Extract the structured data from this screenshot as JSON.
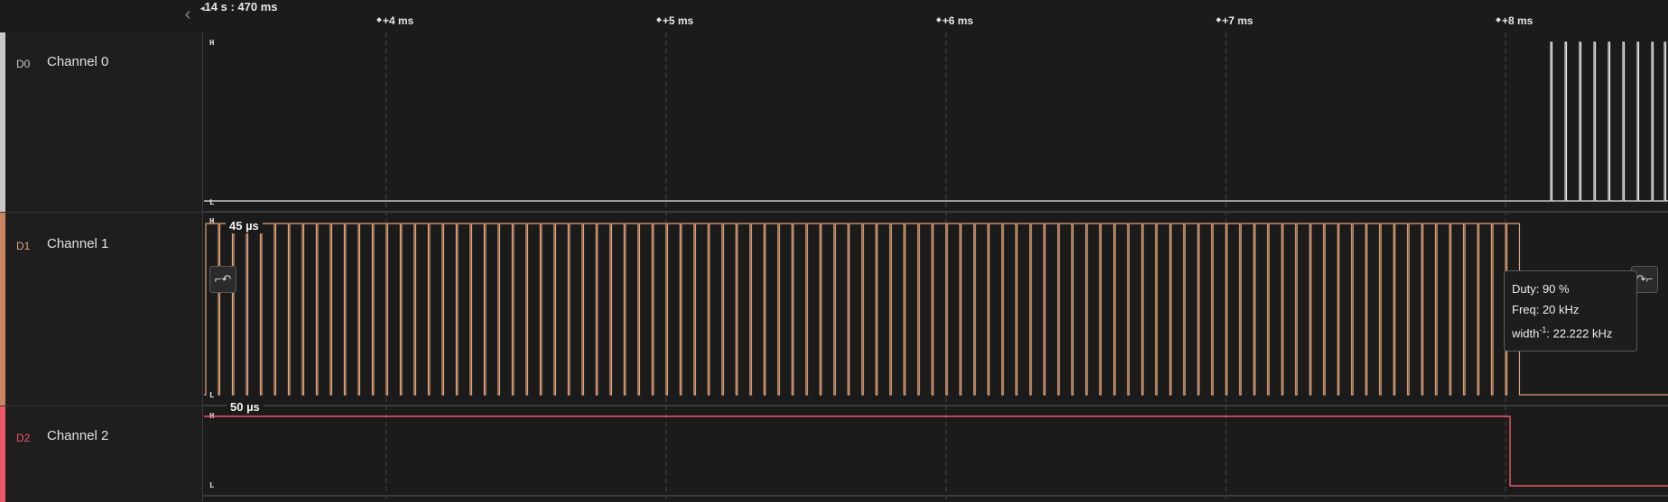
{
  "header": {
    "origin_label": "14 s : 470 ms",
    "collapse_icon": "chevron-left-icon",
    "ticks": [
      "+4 ms",
      "+5 ms",
      "+6 ms",
      "+7 ms",
      "+8 ms"
    ]
  },
  "channels": [
    {
      "id": "D0",
      "name": "Channel 0",
      "color": "#c8c8c8",
      "high_label": "H",
      "low_label": "L"
    },
    {
      "id": "D1",
      "name": "Channel 1",
      "color": "#e0a27a",
      "high_label": "H",
      "low_label": "L",
      "pulse_width_label": "45 µs",
      "duty_cycle_percent": 90
    },
    {
      "id": "D2",
      "name": "Channel 2",
      "color": "#f0566a",
      "high_label": "H",
      "low_label": "L",
      "pulse_width_label": "50 µs"
    }
  ],
  "measurement": {
    "duty": "Duty: 90 %",
    "freq": "Freq: 20 kHz",
    "width_prefix": "width",
    "width_sup": "-1",
    "width_value": ": 22.222 kHz"
  },
  "buttons": {
    "prev_edge_icon": "prev-edge-icon",
    "next_edge_icon": "next-edge-icon",
    "prev_edge_glyph": "⌐↶",
    "next_edge_glyph": "↷⌐"
  }
}
